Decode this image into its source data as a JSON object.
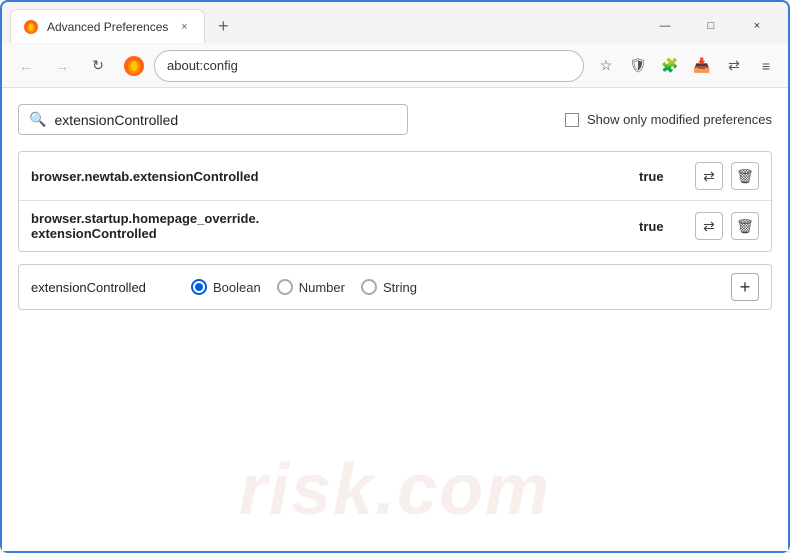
{
  "window": {
    "title": "Advanced Preferences",
    "tab_close": "×",
    "new_tab": "+",
    "minimize": "—",
    "maximize": "□",
    "close": "×"
  },
  "nav": {
    "back_icon": "←",
    "forward_icon": "→",
    "reload_icon": "↻",
    "firefox_label": "Firefox",
    "address": "about:config",
    "bookmark_icon": "☆",
    "shield_icon": "🛡",
    "extension_icon": "🧩",
    "download_icon": "📥",
    "sync_icon": "⇄",
    "menu_icon": "≡"
  },
  "search": {
    "placeholder": "extensionControlled",
    "value": "extensionControlled",
    "checkbox_label": "Show only modified preferences"
  },
  "preferences": [
    {
      "name": "browser.newtab.extensionControlled",
      "value": "true"
    },
    {
      "name": "browser.startup.homepage_override.\nextensionControlled",
      "name_line1": "browser.startup.homepage_override.",
      "name_line2": "extensionControlled",
      "value": "true",
      "multiline": true
    }
  ],
  "add_pref": {
    "name": "extensionControlled",
    "types": [
      {
        "label": "Boolean",
        "selected": true
      },
      {
        "label": "Number",
        "selected": false
      },
      {
        "label": "String",
        "selected": false
      }
    ],
    "add_btn": "+"
  },
  "watermark": "risk.com",
  "icons": {
    "toggle": "⇄",
    "delete": "🗑",
    "search": "🔍"
  }
}
